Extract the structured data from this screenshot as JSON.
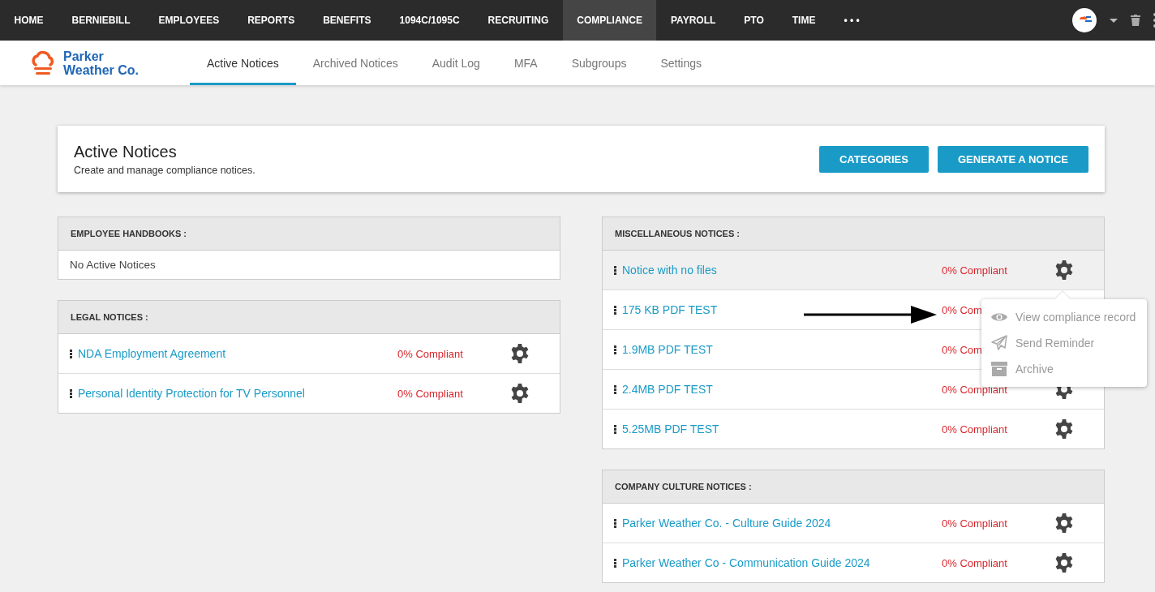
{
  "top_nav": {
    "items": [
      {
        "label": "HOME",
        "selected": false
      },
      {
        "label": "BERNIEBILL",
        "selected": false
      },
      {
        "label": "EMPLOYEES",
        "selected": false
      },
      {
        "label": "REPORTS",
        "selected": false
      },
      {
        "label": "BENEFITS",
        "selected": false
      },
      {
        "label": "1094C/1095C",
        "selected": false
      },
      {
        "label": "RECRUITING",
        "selected": false
      },
      {
        "label": "COMPLIANCE",
        "selected": true
      },
      {
        "label": "PAYROLL",
        "selected": false
      },
      {
        "label": "PTO",
        "selected": false
      },
      {
        "label": "TIME",
        "selected": false
      },
      {
        "label": "• • •",
        "selected": false
      }
    ]
  },
  "brand": {
    "line1": "Parker",
    "line2": "Weather Co."
  },
  "tabs": [
    {
      "label": "Active Notices",
      "selected": true
    },
    {
      "label": "Archived Notices",
      "selected": false
    },
    {
      "label": "Audit Log",
      "selected": false
    },
    {
      "label": "MFA",
      "selected": false
    },
    {
      "label": "Subgroups",
      "selected": false
    },
    {
      "label": "Settings",
      "selected": false
    }
  ],
  "header": {
    "title": "Active Notices",
    "subtitle": "Create and manage compliance notices.",
    "buttons": [
      "CATEGORIES",
      "GENERATE A NOTICE"
    ]
  },
  "left_sections": [
    {
      "title": "EMPLOYEE HANDBOOKS :",
      "empty_text": "No Active Notices"
    },
    {
      "title": "LEGAL NOTICES :",
      "rows": [
        {
          "name": "NDA Employment Agreement",
          "status": "0% Compliant",
          "has_settings": true,
          "highlighted": false
        },
        {
          "name": "Personal Identity Protection for TV Personnel",
          "status": "0% Compliant",
          "has_settings": true,
          "highlighted": false
        }
      ]
    }
  ],
  "right_sections": [
    {
      "title": "MISCELLANEOUS NOTICES :",
      "rows": [
        {
          "name": "Notice with no files",
          "status": "0% Compliant",
          "has_settings": true,
          "highlighted": true
        },
        {
          "name": "175 KB PDF TEST",
          "status": "0% Com",
          "highlighted": false
        },
        {
          "name": "1.9MB PDF TEST",
          "status": "0% Com",
          "highlighted": false
        },
        {
          "name": "2.4MB PDF TEST",
          "status": "0% Compliant",
          "has_settings": true,
          "highlighted": false
        },
        {
          "name": "5.25MB PDF TEST",
          "status": "0% Compliant",
          "has_settings": true,
          "highlighted": false
        }
      ],
      "menu": [
        {
          "kind": "eye",
          "label": "View compliance record",
          "disabled": true
        },
        {
          "kind": "send",
          "label": "Send Reminder",
          "disabled": true
        },
        {
          "kind": "archive",
          "label": "Archive",
          "disabled": true
        }
      ]
    },
    {
      "title": "COMPANY CULTURE NOTICES :",
      "rows": [
        {
          "name": "Parker Weather Co. - Culture Guide 2024",
          "status": "0% Compliant",
          "has_settings": true,
          "highlighted": false
        },
        {
          "name": "Parker Weather Co - Communication Guide 2024",
          "status": "0% Compliant",
          "has_settings": true,
          "highlighted": false
        }
      ]
    }
  ]
}
